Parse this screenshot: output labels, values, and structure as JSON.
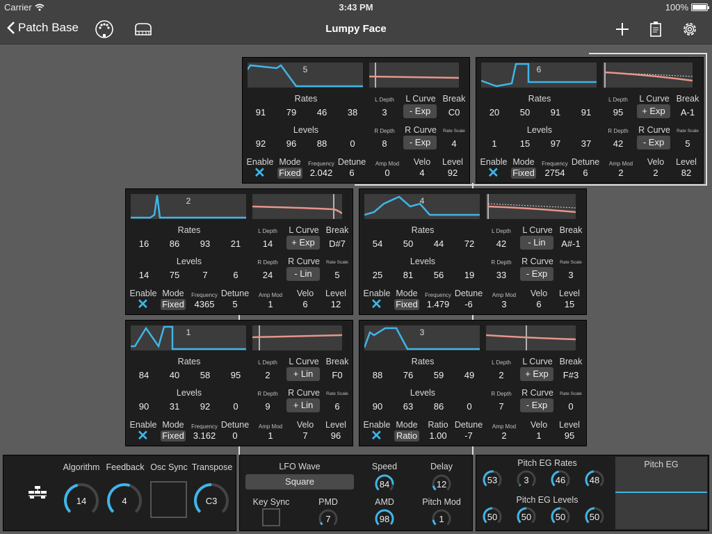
{
  "status": {
    "carrier": "Carrier",
    "time": "3:43 PM",
    "battery": "100%"
  },
  "nav": {
    "back_label": "Patch Base",
    "title": "Lumpy Face"
  },
  "labels": {
    "rates": "Rates",
    "levels": "Levels",
    "enable": "Enable",
    "mode": "Mode",
    "frequency": "Frequency",
    "ratio": "Ratio",
    "detune": "Detune",
    "l_depth": "L Depth",
    "r_depth": "R Depth",
    "l_curve": "L Curve",
    "r_curve": "R Curve",
    "break": "Break",
    "rate_scale": "Rate Scale",
    "amp_mod": "Amp Mod",
    "velo": "Velo",
    "level": "Level"
  },
  "operators": [
    {
      "num": "1",
      "rates": [
        "84",
        "40",
        "58",
        "95"
      ],
      "levels": [
        "90",
        "31",
        "92",
        "0"
      ],
      "mode": "Fixed",
      "freq_label": "Frequency",
      "freq": "3.162",
      "detune": "0",
      "l_depth": "2",
      "l_curve": "+ Lin",
      "break": "F0",
      "r_depth": "9",
      "r_curve": "+ Lin",
      "rate_scale": "6",
      "amp_mod": "1",
      "velo": "7",
      "level": "96",
      "enabled": "✕"
    },
    {
      "num": "2",
      "rates": [
        "16",
        "86",
        "93",
        "21"
      ],
      "levels": [
        "14",
        "75",
        "7",
        "6"
      ],
      "mode": "Fixed",
      "freq_label": "Frequency",
      "freq": "4365",
      "detune": "5",
      "l_depth": "14",
      "l_curve": "+ Exp",
      "break": "D#7",
      "r_depth": "24",
      "r_curve": "- Lin",
      "rate_scale": "5",
      "amp_mod": "1",
      "velo": "6",
      "level": "12",
      "enabled": "✕"
    },
    {
      "num": "3",
      "rates": [
        "88",
        "76",
        "59",
        "49"
      ],
      "levels": [
        "90",
        "63",
        "86",
        "0"
      ],
      "mode": "Ratio",
      "freq_label": "Ratio",
      "freq": "1.00",
      "detune": "-7",
      "l_depth": "2",
      "l_curve": "+ Exp",
      "break": "F#3",
      "r_depth": "7",
      "r_curve": "- Exp",
      "rate_scale": "0",
      "amp_mod": "2",
      "velo": "1",
      "level": "95",
      "enabled": "✕"
    },
    {
      "num": "4",
      "rates": [
        "54",
        "50",
        "44",
        "72"
      ],
      "levels": [
        "25",
        "81",
        "56",
        "19"
      ],
      "mode": "Fixed",
      "freq_label": "Frequency",
      "freq": "1.479",
      "detune": "-6",
      "l_depth": "42",
      "l_curve": "- Lin",
      "break": "A#-1",
      "r_depth": "33",
      "r_curve": "- Exp",
      "rate_scale": "3",
      "amp_mod": "3",
      "velo": "6",
      "level": "15",
      "enabled": "✕"
    },
    {
      "num": "5",
      "rates": [
        "91",
        "79",
        "46",
        "38"
      ],
      "levels": [
        "92",
        "96",
        "88",
        "0"
      ],
      "mode": "Fixed",
      "freq_label": "Frequency",
      "freq": "2.042",
      "detune": "6",
      "l_depth": "3",
      "l_curve": "- Exp",
      "break": "C0",
      "r_depth": "8",
      "r_curve": "- Exp",
      "rate_scale": "4",
      "amp_mod": "0",
      "velo": "4",
      "level": "92",
      "enabled": "✕"
    },
    {
      "num": "6",
      "rates": [
        "20",
        "50",
        "91",
        "91"
      ],
      "levels": [
        "1",
        "15",
        "97",
        "37"
      ],
      "mode": "Fixed",
      "freq_label": "Frequency",
      "freq": "2754",
      "detune": "6",
      "l_depth": "95",
      "l_curve": "+ Exp",
      "break": "A-1",
      "r_depth": "42",
      "r_curve": "- Exp",
      "rate_scale": "5",
      "amp_mod": "2",
      "velo": "2",
      "level": "82",
      "enabled": "✕"
    }
  ],
  "global": {
    "algorithm_label": "Algorithm",
    "algorithm": "14",
    "algorithm_level": 0.45,
    "feedback_label": "Feedback",
    "feedback": "4",
    "feedback_level": 0.57,
    "osc_sync_label": "Osc Sync",
    "transpose_label": "Transpose",
    "transpose": "C3",
    "transpose_level": 0.5
  },
  "lfo": {
    "wave_label": "LFO Wave",
    "wave": "Square",
    "speed_label": "Speed",
    "speed": "84",
    "speed_level": 0.85,
    "delay_label": "Delay",
    "delay": "12",
    "delay_level": 0.12,
    "key_sync_label": "Key Sync",
    "pmd_label": "PMD",
    "pmd": "7",
    "pmd_level": 0.07,
    "amd_label": "AMD",
    "amd": "98",
    "amd_level": 0.98,
    "pitch_mod_label": "Pitch Mod",
    "pitch_mod": "1",
    "pitch_mod_level": 0.14
  },
  "pitch_eg": {
    "rates_label": "Pitch EG Rates",
    "rates": [
      "53",
      "3",
      "46",
      "48"
    ],
    "rate_levels": [
      0.53,
      0.03,
      0.46,
      0.48
    ],
    "levels_label": "Pitch EG Levels",
    "levels": [
      "50",
      "50",
      "50",
      "50"
    ],
    "level_levels": [
      0.5,
      0.5,
      0.5,
      0.5
    ],
    "display_label": "Pitch EG"
  },
  "colors": {
    "accent": "#3fb5e8",
    "curve": "#e8968a",
    "panel": "#1e1e1e",
    "background": "#5c5c5c"
  }
}
